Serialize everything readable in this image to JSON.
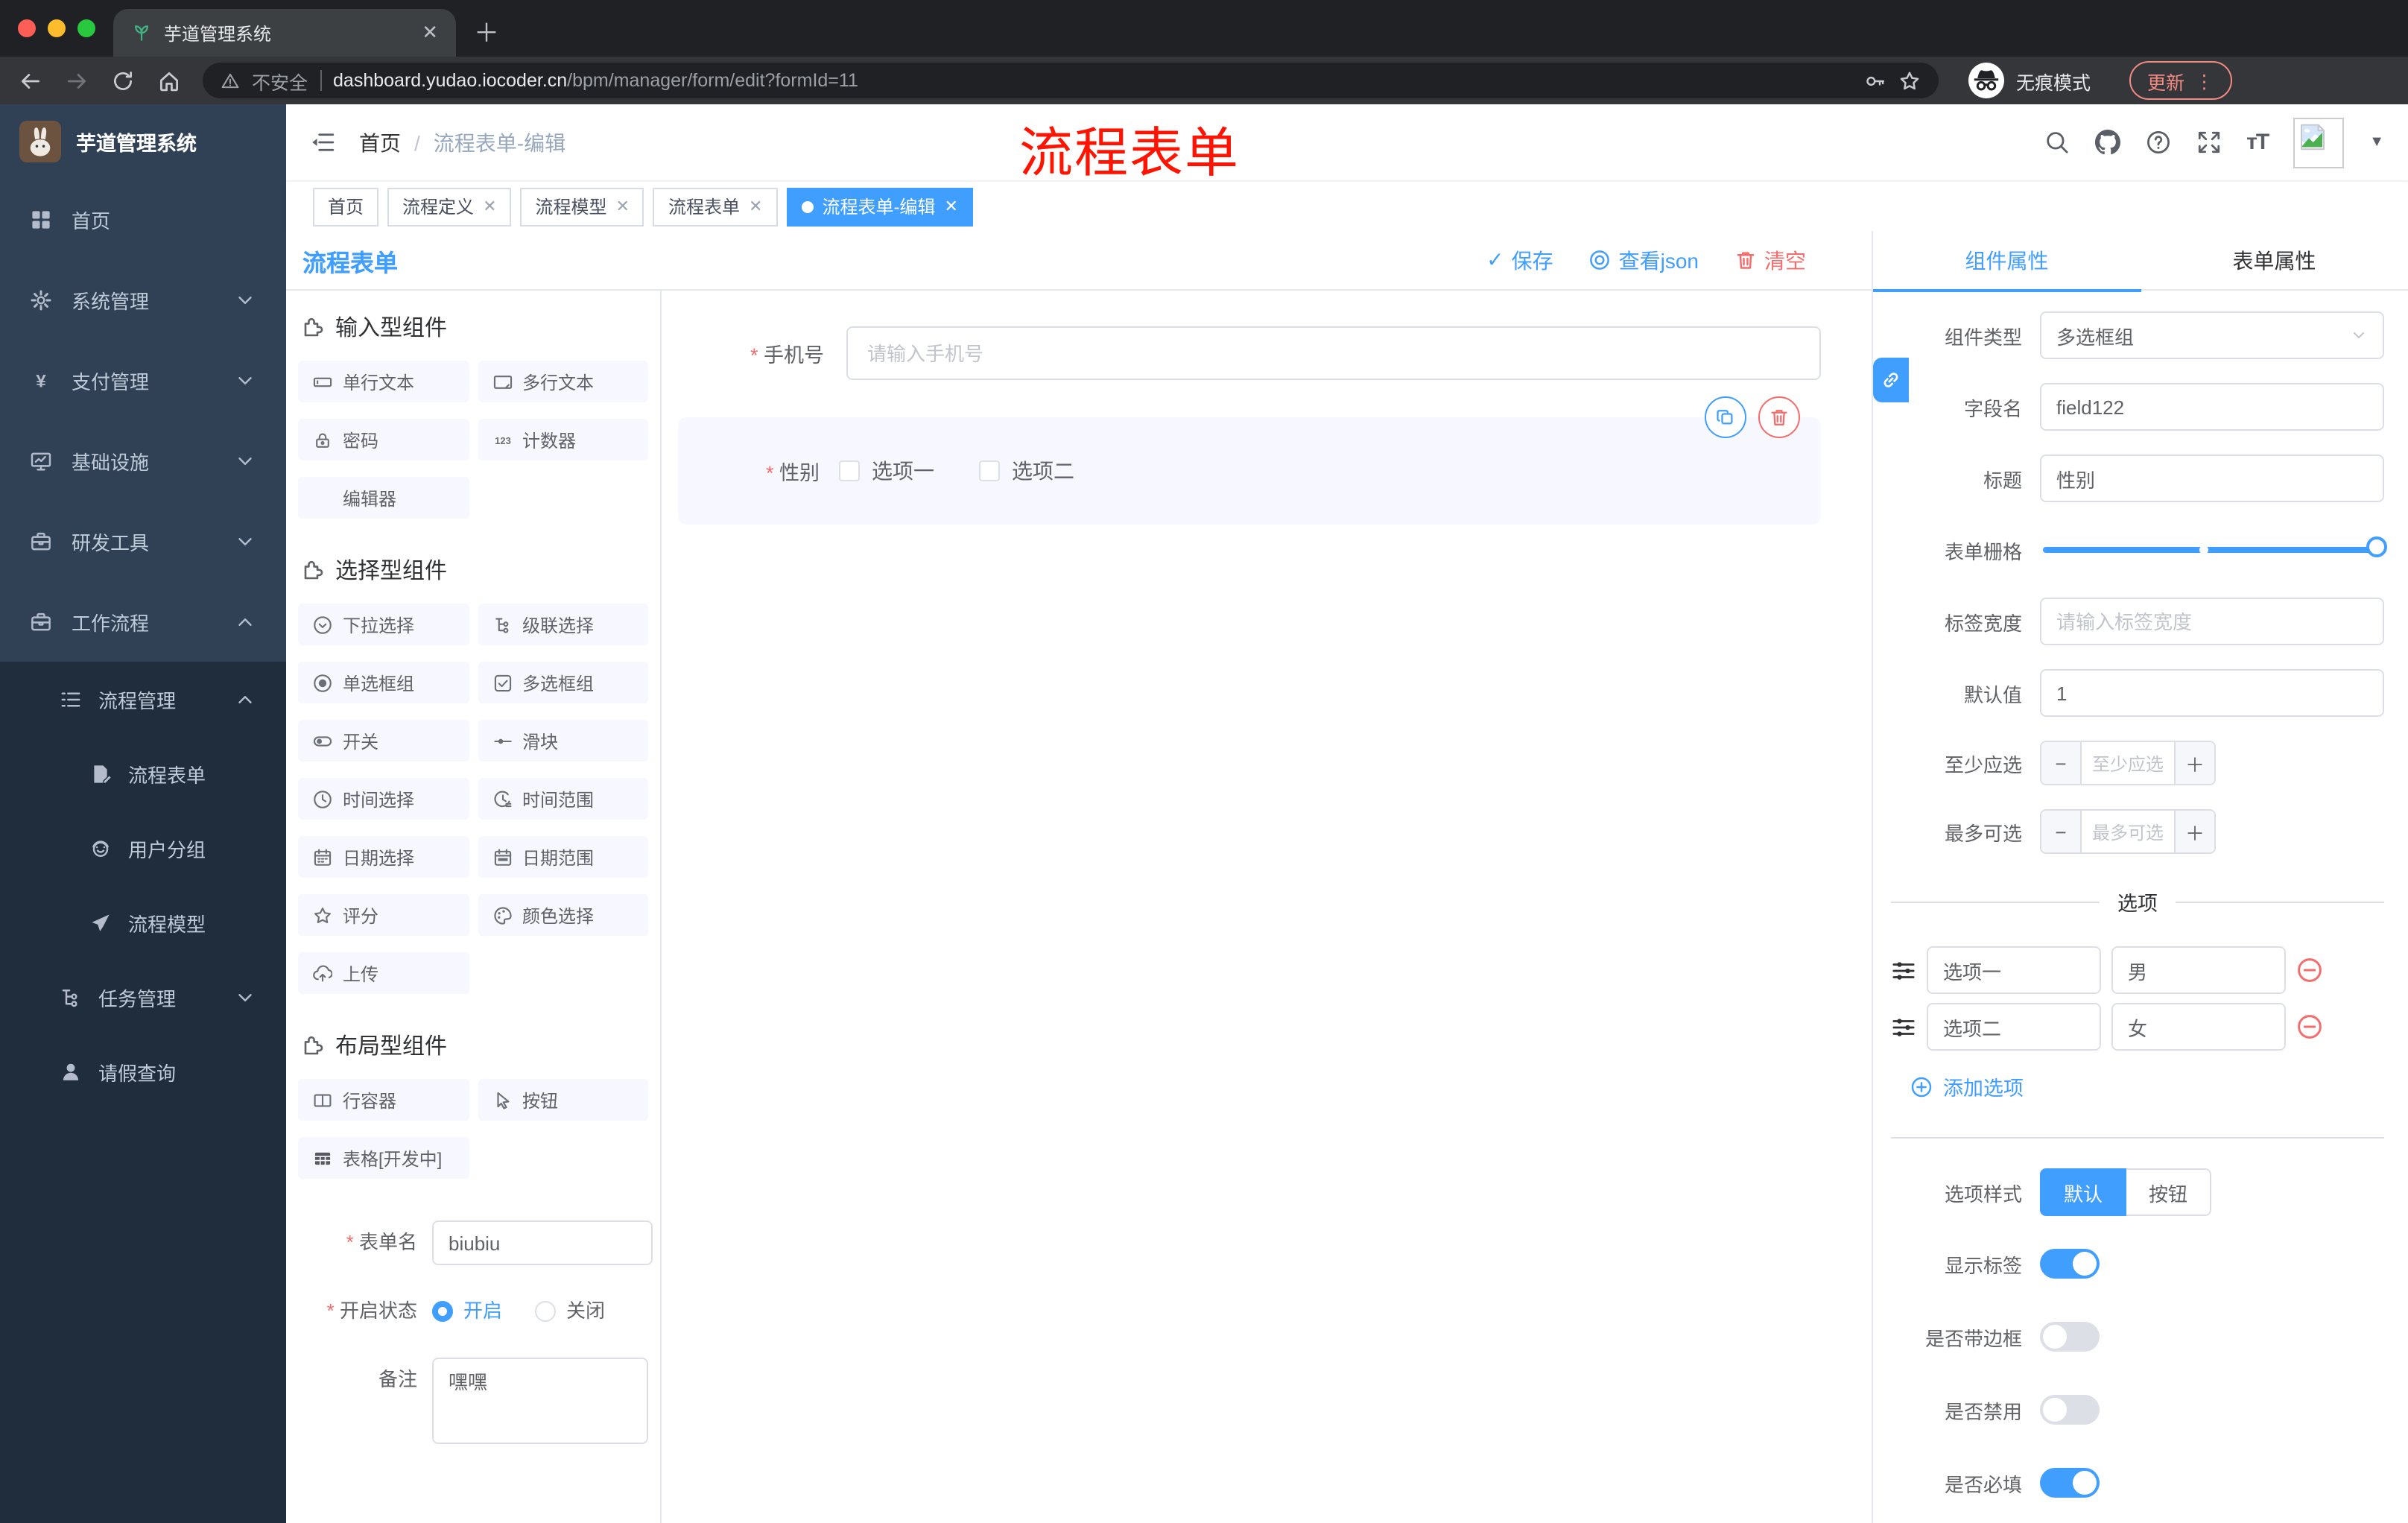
{
  "browser": {
    "tab_title": "芋道管理系统",
    "security_label": "不安全",
    "url_domain": "dashboard.yudao.iocoder.cn",
    "url_path": "/bpm/manager/form/edit?formId=11",
    "incognito_label": "无痕模式",
    "update_label": "更新"
  },
  "sidebar": {
    "logo_title": "芋道管理系统",
    "menu": [
      {
        "label": "首页"
      },
      {
        "label": "系统管理"
      },
      {
        "label": "支付管理"
      },
      {
        "label": "基础设施"
      },
      {
        "label": "研发工具"
      },
      {
        "label": "工作流程"
      }
    ],
    "submenu_parent": "流程管理",
    "submenu_children": [
      {
        "label": "流程表单"
      },
      {
        "label": "用户分组"
      },
      {
        "label": "流程模型"
      }
    ],
    "tail": [
      {
        "label": "任务管理"
      },
      {
        "label": "请假查询"
      }
    ]
  },
  "header": {
    "breadcrumb_home": "首页",
    "breadcrumb_sep": "/",
    "breadcrumb_current": "流程表单-编辑",
    "annotation": "流程表单"
  },
  "tags": [
    {
      "label": "首页"
    },
    {
      "label": "流程定义"
    },
    {
      "label": "流程模型"
    },
    {
      "label": "流程表单"
    },
    {
      "label": "流程表单-编辑"
    }
  ],
  "toolbar": {
    "title": "流程表单",
    "save_label": "保存",
    "view_json_label": "查看json",
    "clear_label": "清空"
  },
  "components": {
    "sections": [
      {
        "title": "输入型组件",
        "items": [
          {
            "label": "单行文本",
            "icon": "input-icon"
          },
          {
            "label": "多行文本",
            "icon": "textarea-icon"
          },
          {
            "label": "密码",
            "icon": "lock-icon"
          },
          {
            "label": "计数器",
            "icon": "counter-icon"
          },
          {
            "label": "编辑器",
            "icon": ""
          }
        ]
      },
      {
        "title": "选择型组件",
        "items": [
          {
            "label": "下拉选择",
            "icon": "select-icon"
          },
          {
            "label": "级联选择",
            "icon": "cascader-icon"
          },
          {
            "label": "单选框组",
            "icon": "radio-icon"
          },
          {
            "label": "多选框组",
            "icon": "checkbox-icon"
          },
          {
            "label": "开关",
            "icon": "switch-icon"
          },
          {
            "label": "滑块",
            "icon": "slider-icon"
          },
          {
            "label": "时间选择",
            "icon": "time-icon"
          },
          {
            "label": "时间范围",
            "icon": "time-range-icon"
          },
          {
            "label": "日期选择",
            "icon": "date-icon"
          },
          {
            "label": "日期范围",
            "icon": "date-range-icon"
          },
          {
            "label": "评分",
            "icon": "rate-icon"
          },
          {
            "label": "颜色选择",
            "icon": "color-icon"
          },
          {
            "label": "上传",
            "icon": "upload-icon"
          }
        ]
      },
      {
        "title": "布局型组件",
        "items": [
          {
            "label": "行容器",
            "icon": "row-icon"
          },
          {
            "label": "按钮",
            "icon": "button-icon"
          },
          {
            "label": "表格[开发中]",
            "icon": "table-icon"
          }
        ]
      }
    ]
  },
  "meta_form": {
    "name_label": "表单名",
    "name_value": "biubiu",
    "status_label": "开启状态",
    "status_on_label": "开启",
    "status_off_label": "关闭",
    "remark_label": "备注",
    "remark_value": "嘿嘿"
  },
  "canvas": {
    "phone_label": "手机号",
    "phone_placeholder": "请输入手机号",
    "gender_label": "性别",
    "gender_option1": "选项一",
    "gender_option2": "选项二"
  },
  "inspector": {
    "tab_component": "组件属性",
    "tab_form": "表单属性",
    "component_type_label": "组件类型",
    "component_type_value": "多选框组",
    "field_name_label": "字段名",
    "field_name_value": "field122",
    "title_label": "标题",
    "title_value": "性别",
    "grid_label": "表单栅格",
    "label_width_label": "标签宽度",
    "label_width_placeholder": "请输入标签宽度",
    "default_label": "默认值",
    "default_value": "1",
    "min_label": "至少应选",
    "min_placeholder": "至少应选",
    "max_label": "最多可选",
    "max_placeholder": "最多可选",
    "options_title": "选项",
    "options": [
      {
        "label": "选项一",
        "value": "男"
      },
      {
        "label": "选项二",
        "value": "女"
      }
    ],
    "add_option_label": "添加选项",
    "option_style_label": "选项样式",
    "option_style_default": "默认",
    "option_style_button": "按钮",
    "show_label_label": "显示标签",
    "border_label": "是否带边框",
    "disabled_label": "是否禁用",
    "required_label": "是否必填"
  },
  "colors": {
    "accent": "#409eff",
    "danger": "#f56c6c",
    "annotation_red": "#fe1400",
    "sidebar_bg": "#304156",
    "submenu_bg": "#1f2d3d",
    "chip_bg": "#f6f7ff"
  }
}
